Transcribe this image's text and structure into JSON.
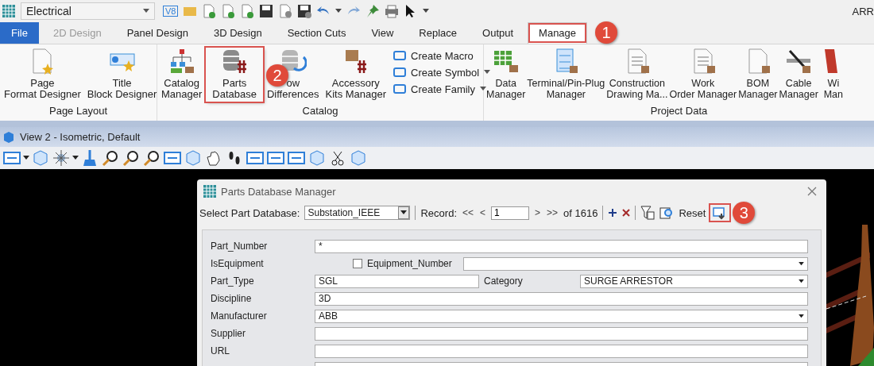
{
  "app_bar": {
    "workspace": "Electrical",
    "version_badge": "V8",
    "title_fragment": "ARR"
  },
  "ribbon_tabs": [
    {
      "label": "File",
      "kind": "file",
      "selected": false,
      "disabled": false,
      "highlighted": false
    },
    {
      "label": "2D Design",
      "kind": "tab",
      "selected": false,
      "disabled": true,
      "highlighted": false
    },
    {
      "label": "Panel Design",
      "kind": "tab",
      "selected": false,
      "disabled": false,
      "highlighted": false
    },
    {
      "label": "3D Design",
      "kind": "tab",
      "selected": false,
      "disabled": false,
      "highlighted": false
    },
    {
      "label": "Section Cuts",
      "kind": "tab",
      "selected": false,
      "disabled": false,
      "highlighted": false
    },
    {
      "label": "View",
      "kind": "tab",
      "selected": false,
      "disabled": false,
      "highlighted": false
    },
    {
      "label": "Replace",
      "kind": "tab",
      "selected": false,
      "disabled": false,
      "highlighted": false
    },
    {
      "label": "Output",
      "kind": "tab",
      "selected": false,
      "disabled": false,
      "highlighted": false
    },
    {
      "label": "Manage",
      "kind": "tab",
      "selected": true,
      "disabled": false,
      "highlighted": true
    }
  ],
  "ribbon_groups": [
    {
      "title": "Page Layout",
      "buttons": [
        {
          "kind": "large",
          "label_lines": [
            "Page",
            "Format Designer"
          ],
          "highlighted": false
        },
        {
          "kind": "large",
          "label_lines": [
            "Title",
            "Block Designer"
          ],
          "highlighted": false
        }
      ]
    },
    {
      "title": "Catalog",
      "buttons": [
        {
          "kind": "large",
          "label_lines": [
            "Catalog",
            "Manager"
          ],
          "highlighted": false
        },
        {
          "kind": "large",
          "label_lines": [
            "Parts",
            "Database"
          ],
          "highlighted": true
        },
        {
          "kind": "large",
          "label_lines": [
            "ow",
            "Differences"
          ],
          "highlighted": false
        },
        {
          "kind": "large",
          "label_lines": [
            "Accessory",
            "Kits Manager"
          ],
          "highlighted": false
        },
        {
          "kind": "small_stack",
          "items": [
            {
              "label": "Create Macro",
              "has_menu": false
            },
            {
              "label": "Create Symbol",
              "has_menu": true
            },
            {
              "label": "Create Family",
              "has_menu": true
            }
          ]
        }
      ]
    },
    {
      "title": "Project Data",
      "buttons": [
        {
          "kind": "large",
          "label_lines": [
            "Data",
            "Manager"
          ],
          "highlighted": false
        },
        {
          "kind": "large",
          "label_lines": [
            "Terminal/Pin-Plug",
            "Manager"
          ],
          "highlighted": false
        },
        {
          "kind": "large",
          "label_lines": [
            "Construction",
            "Drawing Ma..."
          ],
          "highlighted": false
        },
        {
          "kind": "large",
          "label_lines": [
            "Work",
            "Order Manager"
          ],
          "highlighted": false
        },
        {
          "kind": "large",
          "label_lines": [
            "BOM",
            "Manager"
          ],
          "highlighted": false
        },
        {
          "kind": "large",
          "label_lines": [
            "Cable",
            "Manager"
          ],
          "highlighted": false
        },
        {
          "kind": "large",
          "label_lines": [
            "Wi",
            "Man"
          ],
          "highlighted": false
        }
      ]
    }
  ],
  "callouts": [
    {
      "number": "1"
    },
    {
      "number": "2"
    },
    {
      "number": "3"
    }
  ],
  "view": {
    "title": "View 2 - Isometric, Default"
  },
  "dialog": {
    "title": "Parts Database Manager",
    "database_label": "Select Part Database:",
    "database": "Substation_IEEE",
    "record_label": "Record:",
    "first": "<<",
    "previous": "<",
    "record": "1",
    "next": ">",
    "last": ">>",
    "record_count": "of 1616",
    "reset": "Reset",
    "export_highlighted": true,
    "fields": [
      {
        "kind": "text",
        "label": "Part_Number",
        "value": "*"
      },
      {
        "kind": "checkbox_dropdown",
        "label": "IsEquipment",
        "checked": false,
        "sub_label": "Equipment_Number"
      },
      {
        "kind": "text_dropdown",
        "label": "Part_Type",
        "value": "SGL",
        "sub_label": "Category",
        "sub_value": "SURGE ARRESTOR"
      },
      {
        "kind": "text",
        "label": "Discipline",
        "value": "3D"
      },
      {
        "kind": "dropdown",
        "label": "Manufacturer",
        "value": "ABB"
      },
      {
        "kind": "text",
        "label": "Supplier"
      },
      {
        "kind": "text",
        "label": "URL"
      },
      {
        "kind": "text"
      }
    ]
  }
}
